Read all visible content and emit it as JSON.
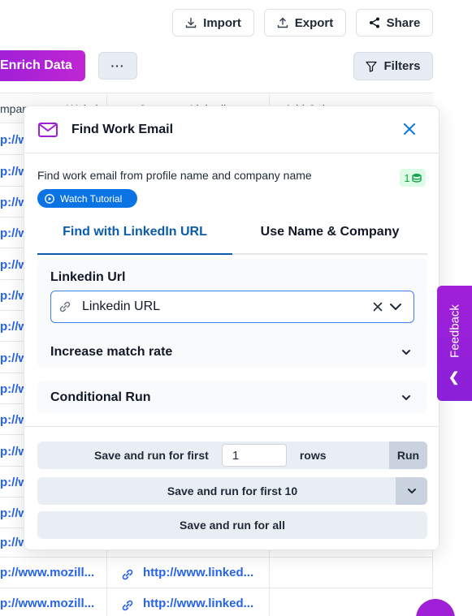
{
  "toolbar": {
    "import_label": "Import",
    "export_label": "Export",
    "share_label": "Share",
    "enrich_label": "Enrich Data",
    "more_label": "···",
    "filters_label": "Filters"
  },
  "table": {
    "headers": [
      "mpan",
      "Websi",
      "Company Linkedi",
      "Add Col"
    ],
    "rows": [
      {
        "a": "p://w"
      },
      {
        "a": "p://w"
      },
      {
        "a": "p://w"
      },
      {
        "a": "p://w"
      },
      {
        "a": "p://w"
      },
      {
        "a": "p://w"
      },
      {
        "a": "p://w"
      },
      {
        "a": "p://w"
      },
      {
        "a": "p://w"
      },
      {
        "a": "p://w"
      },
      {
        "a": "p://w"
      },
      {
        "a": "p://w"
      },
      {
        "a": "p://w"
      },
      {
        "a": "p://w"
      }
    ],
    "bottom_rows": [
      {
        "website": "p://www.mozill...",
        "linkedin": "http://www.linked..."
      },
      {
        "website": "p://www.mozill...",
        "linkedin": "http://www.linked..."
      }
    ]
  },
  "modal": {
    "title": "Find Work Email",
    "description": "Find work email from profile name and company name",
    "credits": "1",
    "tutorial_label": "Watch Tutorial",
    "tabs": [
      {
        "label": "Find with LinkedIn URL",
        "active": true
      },
      {
        "label": "Use Name & Company",
        "active": false
      }
    ],
    "linkedin_field": {
      "label": "Linkedin Url",
      "value": "Linkedin URL"
    },
    "accordions": [
      {
        "label": "Increase match rate"
      },
      {
        "label": "Conditional Run"
      }
    ],
    "footer": {
      "run_first_prefix": "Save and run for first",
      "run_first_count": "1",
      "run_first_suffix": "rows",
      "run_button": "Run",
      "run_first_10": "Save and run for first 10",
      "run_all": "Save and run for all"
    }
  },
  "feedback": {
    "label": "Feedback",
    "arrow": "❮"
  },
  "colors": {
    "accent_purple": "#a020d8",
    "accent_blue": "#0b5cad",
    "link_blue": "#2563eb",
    "credit_green": "#16a34a"
  }
}
